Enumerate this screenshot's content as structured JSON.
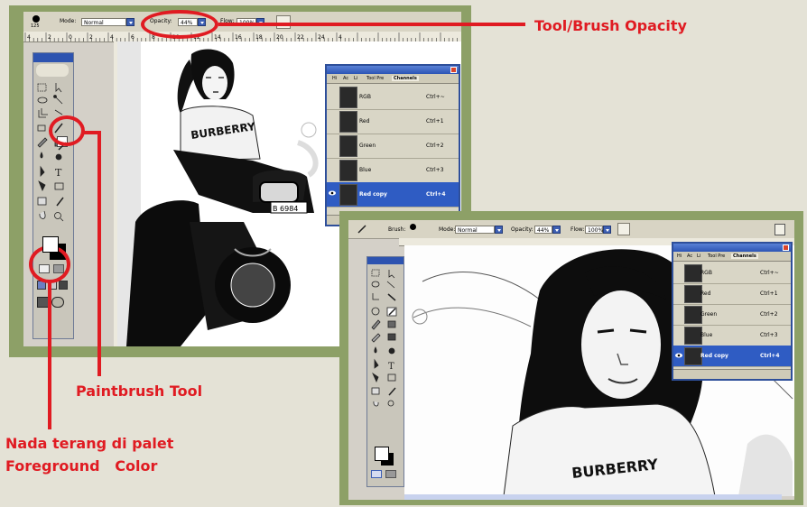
{
  "annotations": {
    "opacity_label": "Tool/Brush Opacity",
    "paintbrush_label": "Paintbrush Tool",
    "foreground_label_line1": "Nada terang di palet",
    "foreground_label_line2": "Foreground   Color",
    "accent_color": "#e01b22",
    "frame_color": "#8da067"
  },
  "window1": {
    "brush_size": "125",
    "mode_label": "Mode:",
    "mode_value": "Normal",
    "opacity_label": "Opacity:",
    "opacity_value": "44%",
    "flow_label": "Flow:",
    "flow_value": "100%",
    "ruler_ticks": [
      "4",
      "2",
      "0",
      "2",
      "4",
      "6",
      "8",
      "10",
      "12",
      "14",
      "16",
      "18",
      "20",
      "22",
      "24",
      "4"
    ],
    "panel_tabs": [
      "Hi",
      "Ac",
      "Li",
      "Tool Pre",
      "Channels"
    ],
    "channels": [
      {
        "name": "RGB",
        "shortcut": "Ctrl+~"
      },
      {
        "name": "Red",
        "shortcut": "Ctrl+1"
      },
      {
        "name": "Green",
        "shortcut": "Ctrl+2"
      },
      {
        "name": "Blue",
        "shortcut": "Ctrl+3"
      },
      {
        "name": "Red copy",
        "shortcut": "Ctrl+4",
        "selected": true
      }
    ]
  },
  "window2": {
    "brush_label": "Brush:",
    "mode_label": "Mode:",
    "mode_value": "Normal",
    "opacity_label": "Opacity:",
    "opacity_value": "44%",
    "flow_label": "Flow:",
    "flow_value": "100%",
    "panel_tabs": [
      "Hi",
      "Ac",
      "Li",
      "Tool Pre",
      "Channels"
    ],
    "channels": [
      {
        "name": "RGB",
        "shortcut": "Ctrl+~"
      },
      {
        "name": "Red",
        "shortcut": "Ctrl+1"
      },
      {
        "name": "Green",
        "shortcut": "Ctrl+2"
      },
      {
        "name": "Blue",
        "shortcut": "Ctrl+3"
      },
      {
        "name": "Red copy",
        "shortcut": "Ctrl+4",
        "selected": true
      }
    ]
  },
  "icons": [
    "brush-icon",
    "move-icon",
    "marquee-icon",
    "lasso-icon",
    "magic-wand-icon",
    "crop-icon",
    "healing-icon",
    "paintbrush-icon",
    "stamp-icon",
    "history-brush-icon",
    "eraser-icon",
    "gradient-icon",
    "dodge-icon",
    "pen-icon",
    "type-icon",
    "path-select-icon",
    "shape-icon",
    "notes-icon",
    "eyedropper-icon",
    "hand-icon",
    "zoom-icon",
    "foreground-color-icon",
    "quick-mask-icon",
    "screen-mode-icon",
    "eye-icon",
    "close-icon"
  ]
}
